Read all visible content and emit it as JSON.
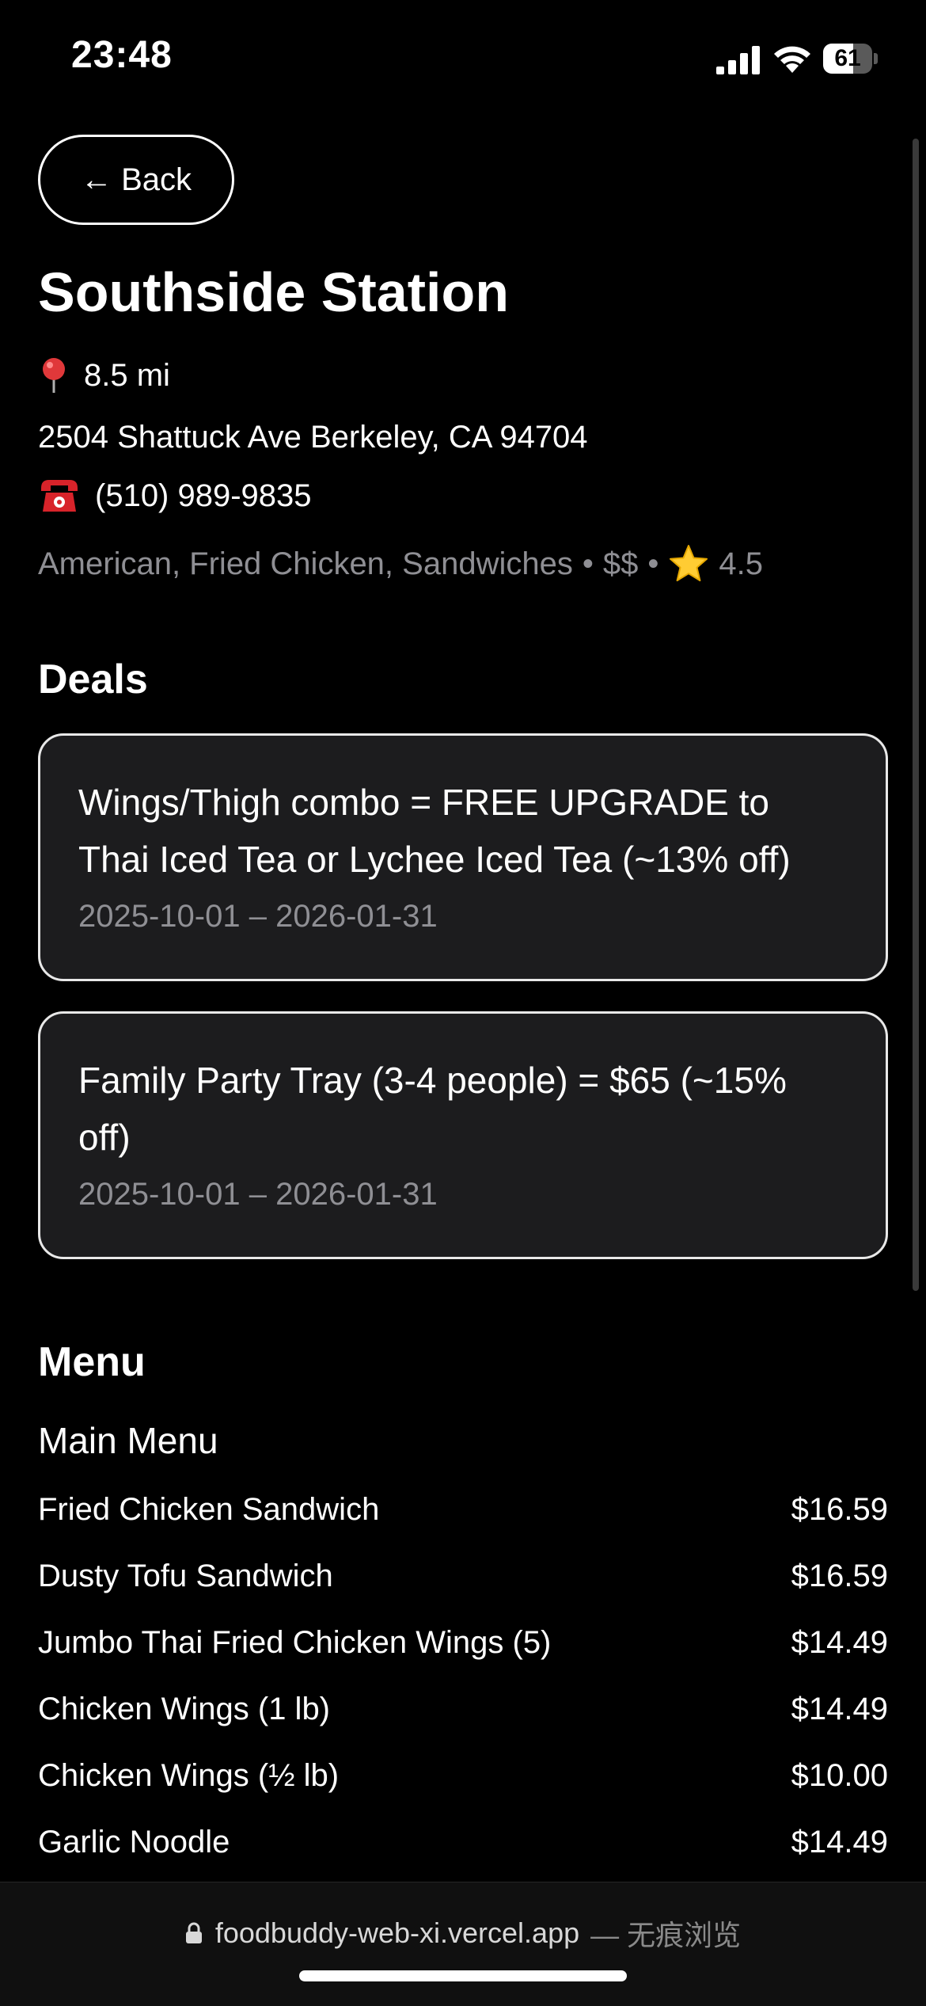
{
  "status_bar": {
    "time": "23:48",
    "battery_level": "61",
    "battery_fraction": 0.61
  },
  "header": {
    "back_label": "← Back"
  },
  "restaurant": {
    "name": "Southside Station",
    "distance": "8.5 mi",
    "address": "2504 Shattuck Ave Berkeley, CA 94704",
    "phone": "(510) 989-9835",
    "cuisines": "American, Fried Chicken, Sandwiches",
    "price": "$$",
    "rating": "4.5",
    "separator": "•"
  },
  "deals": {
    "heading": "Deals",
    "items": [
      {
        "title": "Wings/Thigh combo = FREE UPGRADE to Thai Iced Tea or Lychee Iced Tea (~13% off)",
        "dates": "2025-10-01 – 2026-01-31"
      },
      {
        "title": "Family Party Tray (3-4 people) = $65 (~15% off)",
        "dates": "2025-10-01 – 2026-01-31"
      }
    ]
  },
  "menu": {
    "heading": "Menu",
    "section_title": "Main Menu",
    "items": [
      {
        "name": "Fried Chicken Sandwich",
        "price": "$16.59"
      },
      {
        "name": "Dusty Tofu Sandwich",
        "price": "$16.59"
      },
      {
        "name": "Jumbo Thai Fried Chicken Wings (5)",
        "price": "$14.49"
      },
      {
        "name": "Chicken Wings (1 lb)",
        "price": "$14.49"
      },
      {
        "name": "Chicken Wings (½ lb)",
        "price": "$10.00"
      },
      {
        "name": "Garlic Noodle",
        "price": "$14.49"
      }
    ]
  },
  "browser": {
    "url": "foodbuddy-web-xi.vercel.app",
    "mode_label": "— 无痕浏览"
  },
  "icons": {
    "signal": "cellular-signal-icon",
    "wifi": "wifi-icon",
    "battery": "battery-icon",
    "pin": "location-pin-icon",
    "phone": "telephone-icon",
    "star": "star-icon",
    "lock": "lock-icon"
  },
  "colors": {
    "background": "#000000",
    "card_background": "#1c1c1e",
    "muted_text": "#8f8f94",
    "pin_red": "#e0383a",
    "phone_red": "#d8232a",
    "star_gold": "#ffcc33"
  }
}
